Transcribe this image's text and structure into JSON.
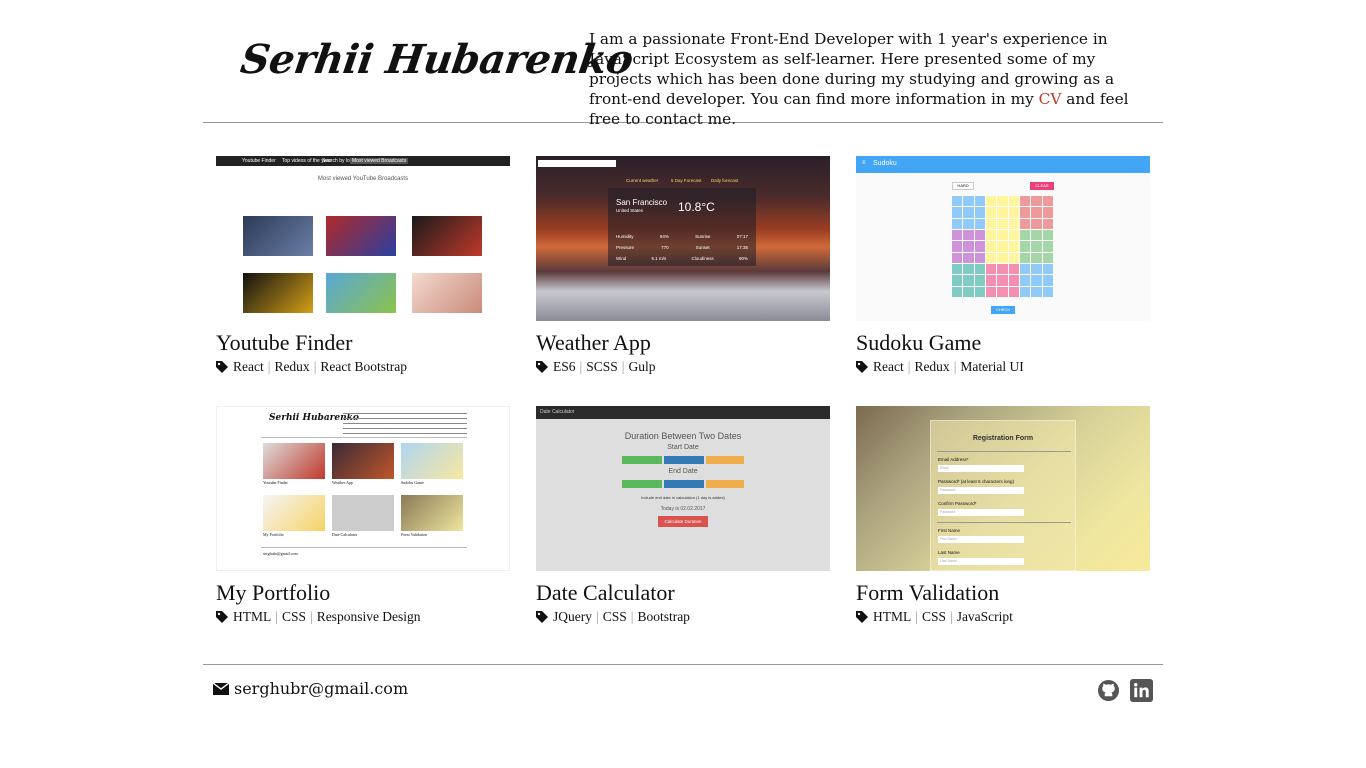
{
  "header": {
    "name": "Serhii Hubarenko",
    "intro_before": "I am a passionate Front-End Developer with 1 year's experience in JavaScript Ecosystem as self-learner. Here presented some of my projects which has been done during my studying and growing as a front-end developer. You can find more information in my ",
    "cv_link": "CV",
    "intro_after": " and feel free to contact me."
  },
  "projects": [
    {
      "title": "Youtube Finder",
      "tags": [
        "React",
        "Redux",
        "React Bootstrap"
      ]
    },
    {
      "title": "Weather App",
      "tags": [
        "ES6",
        "SCSS",
        "Gulp"
      ]
    },
    {
      "title": "Sudoku Game",
      "tags": [
        "React",
        "Redux",
        "Material UI"
      ]
    },
    {
      "title": "My Portfolio",
      "tags": [
        "HTML",
        "CSS",
        "Responsive Design"
      ]
    },
    {
      "title": "Date Calculator",
      "tags": [
        "JQuery",
        "CSS",
        "Bootstrap"
      ]
    },
    {
      "title": "Form Validation",
      "tags": [
        "HTML",
        "CSS",
        "JavaScript"
      ]
    }
  ],
  "thumbnails": {
    "youtube": {
      "app_name": "Youtube Finder",
      "menu": [
        "Top videos of the year",
        "Search by location",
        "Most viewed Broadcasts"
      ],
      "heading": "Most viewed YouTube Broadcasts"
    },
    "weather": {
      "city": "San Francisco",
      "country": "United States",
      "temp": "10.8°C",
      "tabs": [
        "Current weather",
        "5 Day Forecast",
        "Daily forecast"
      ],
      "rows": [
        [
          "Humidity",
          "94%",
          "Sunrise",
          "07:17"
        ],
        [
          "Pressure",
          "770",
          "Sunset",
          "17:35"
        ],
        [
          "Wind",
          "5.1 m/s",
          "Cloudiness",
          "90%"
        ]
      ]
    },
    "sudoku": {
      "title": "Sudoku",
      "hard_label": "HARD",
      "clear_label": "CLEAR",
      "check_label": "CHECK"
    },
    "portfolio": {
      "name": "Serhii Hubarenko",
      "titles": [
        "Youtube Finder",
        "Weather App",
        "Sudoku Game",
        "My Portfolio",
        "Date Calculator",
        "Form Validation"
      ],
      "email": "serghubr@gmail.com"
    },
    "date": {
      "app_name": "Date Calculator",
      "heading": "Duration Between Two Dates",
      "start": "Start Date",
      "end": "End Date",
      "checkbox": "Include end date in calculation (1 day is added)",
      "result": "Today is 02.02.2017",
      "button": "Calculate Duration"
    },
    "form": {
      "heading": "Registration Form",
      "labels": [
        "Email Address*",
        "Password* (at least 6 characters long)",
        "Confirm Password*",
        "First Name",
        "Last Name"
      ],
      "placeholders": [
        "Email",
        "Password",
        "Password",
        "First Name",
        "Last Name"
      ]
    }
  },
  "footer": {
    "email": "serghubr@gmail.com"
  },
  "icons": {
    "tag": "tag-icon",
    "mail": "envelope-icon",
    "github": "github-icon",
    "linkedin": "linkedin-icon"
  },
  "colors": {
    "accent": "#c0392b",
    "sudoku_bar": "#42a5f5",
    "icon_gray": "#555555"
  }
}
